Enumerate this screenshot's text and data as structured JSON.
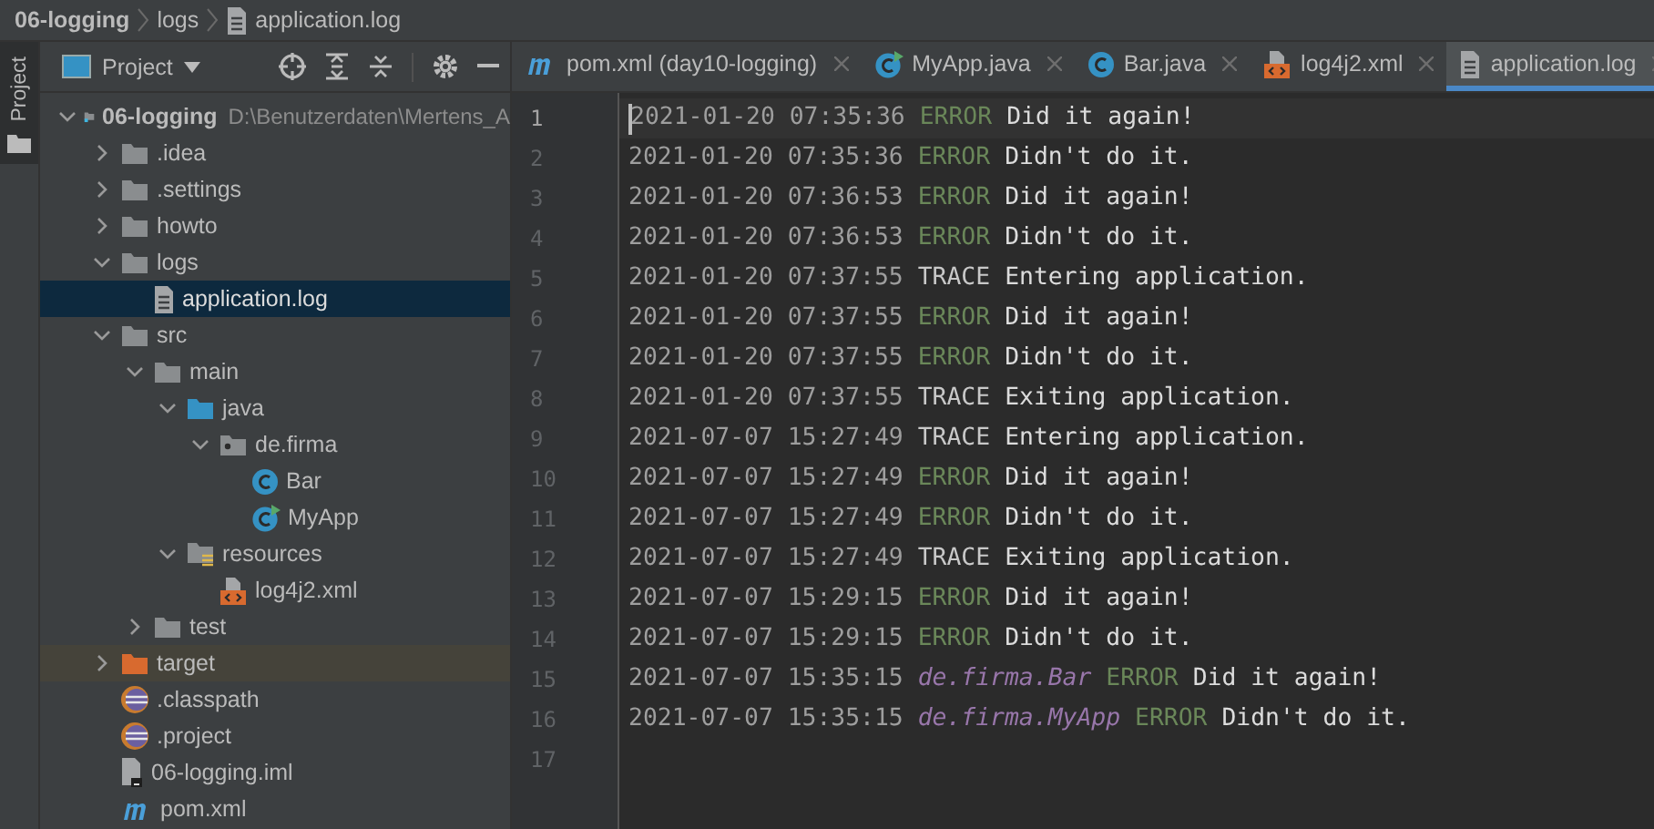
{
  "breadcrumb": [
    {
      "label": "06-logging",
      "kind": "project"
    },
    {
      "label": "logs",
      "kind": "folder"
    },
    {
      "label": "application.log",
      "kind": "log"
    }
  ],
  "side_stripe": {
    "label": "Project",
    "selected": true
  },
  "project_panel": {
    "title": "Project"
  },
  "tree": [
    {
      "label": "06-logging",
      "path": "D:\\Benutzerdaten\\Mertens_A",
      "kind": "module",
      "expanded": true,
      "selected": false,
      "children": [
        {
          "label": ".idea",
          "kind": "folder",
          "expanded": false,
          "selected": false
        },
        {
          "label": ".settings",
          "kind": "folder",
          "expanded": false,
          "selected": false
        },
        {
          "label": "howto",
          "kind": "folder",
          "expanded": false,
          "selected": false
        },
        {
          "label": "logs",
          "kind": "folder",
          "expanded": true,
          "selected": false,
          "children": [
            {
              "label": "application.log",
              "kind": "log",
              "selected": true
            }
          ]
        },
        {
          "label": "src",
          "kind": "folder",
          "expanded": true,
          "selected": false,
          "children": [
            {
              "label": "main",
              "kind": "folder",
              "expanded": true,
              "selected": false,
              "children": [
                {
                  "label": "java",
                  "kind": "source",
                  "expanded": true,
                  "selected": false,
                  "children": [
                    {
                      "label": "de.firma",
                      "kind": "package",
                      "expanded": true,
                      "selected": false,
                      "children": [
                        {
                          "label": "Bar",
                          "kind": "class",
                          "selected": false
                        },
                        {
                          "label": "MyApp",
                          "kind": "main-class",
                          "selected": false
                        }
                      ]
                    }
                  ]
                },
                {
                  "label": "resources",
                  "kind": "resources",
                  "expanded": true,
                  "selected": false,
                  "children": [
                    {
                      "label": "log4j2.xml",
                      "kind": "xml",
                      "selected": false
                    }
                  ]
                }
              ]
            },
            {
              "label": "test",
              "kind": "folder",
              "expanded": false,
              "selected": false
            }
          ]
        },
        {
          "label": "target",
          "kind": "excluded",
          "expanded": false,
          "selected": false
        },
        {
          "label": ".classpath",
          "kind": "eclipse",
          "selected": false
        },
        {
          "label": ".project",
          "kind": "eclipse",
          "selected": false
        },
        {
          "label": "06-logging.iml",
          "kind": "iml",
          "selected": false
        },
        {
          "label": "pom.xml",
          "kind": "maven",
          "selected": false
        }
      ]
    }
  ],
  "tabs": [
    {
      "label": "pom.xml (day10-logging)",
      "kind": "maven",
      "selected": false
    },
    {
      "label": "MyApp.java",
      "kind": "main-class",
      "selected": false
    },
    {
      "label": "Bar.java",
      "kind": "class",
      "selected": false
    },
    {
      "label": "log4j2.xml",
      "kind": "xml",
      "selected": false
    },
    {
      "label": "application.log",
      "kind": "log",
      "selected": true
    }
  ],
  "lines": [
    {
      "number": "1",
      "current": true,
      "timestamp": "2021-01-20 07:35:36",
      "level": "ERROR",
      "color": "#6a8759",
      "message": "Did it again!"
    },
    {
      "number": "2",
      "current": false,
      "timestamp": "2021-01-20 07:35:36",
      "level": "ERROR",
      "color": "#6a8759",
      "message": "Didn't do it."
    },
    {
      "number": "3",
      "current": false,
      "timestamp": "2021-01-20 07:36:53",
      "level": "ERROR",
      "color": "#6a8759",
      "message": "Did it again!"
    },
    {
      "number": "4",
      "current": false,
      "timestamp": "2021-01-20 07:36:53",
      "level": "ERROR",
      "color": "#6a8759",
      "message": "Didn't do it."
    },
    {
      "number": "5",
      "current": false,
      "timestamp": "2021-01-20 07:37:55",
      "level": "TRACE",
      "color": "#c8c8c8",
      "message": "Entering application."
    },
    {
      "number": "6",
      "current": false,
      "timestamp": "2021-01-20 07:37:55",
      "level": "ERROR",
      "color": "#6a8759",
      "message": "Did it again!"
    },
    {
      "number": "7",
      "current": false,
      "timestamp": "2021-01-20 07:37:55",
      "level": "ERROR",
      "color": "#6a8759",
      "message": "Didn't do it."
    },
    {
      "number": "8",
      "current": false,
      "timestamp": "2021-01-20 07:37:55",
      "level": "TRACE",
      "color": "#c8c8c8",
      "message": "Exiting application."
    },
    {
      "number": "9",
      "current": false,
      "timestamp": "2021-07-07 15:27:49",
      "level": "TRACE",
      "color": "#c8c8c8",
      "message": "Entering application."
    },
    {
      "number": "10",
      "current": false,
      "timestamp": "2021-07-07 15:27:49",
      "level": "ERROR",
      "color": "#6a8759",
      "message": "Did it again!"
    },
    {
      "number": "11",
      "current": false,
      "timestamp": "2021-07-07 15:27:49",
      "level": "ERROR",
      "color": "#6a8759",
      "message": "Didn't do it."
    },
    {
      "number": "12",
      "current": false,
      "timestamp": "2021-07-07 15:27:49",
      "level": "TRACE",
      "color": "#c8c8c8",
      "message": "Exiting application."
    },
    {
      "number": "13",
      "current": false,
      "timestamp": "2021-07-07 15:29:15",
      "level": "ERROR",
      "color": "#6a8759",
      "message": "Did it again!"
    },
    {
      "number": "14",
      "current": false,
      "timestamp": "2021-07-07 15:29:15",
      "level": "ERROR",
      "color": "#6a8759",
      "message": "Didn't do it."
    },
    {
      "number": "15",
      "current": false,
      "timestamp": "2021-07-07 15:35:15",
      "logger": "de.firma.Bar",
      "level": "ERROR",
      "color": "#6a8759",
      "message": "Did it again!"
    },
    {
      "number": "16",
      "current": false,
      "timestamp": "2021-07-07 15:35:15",
      "logger": "de.firma.MyApp",
      "level": "ERROR",
      "color": "#6a8759",
      "message": "Didn't do it."
    },
    {
      "number": "17",
      "current": false
    }
  ]
}
